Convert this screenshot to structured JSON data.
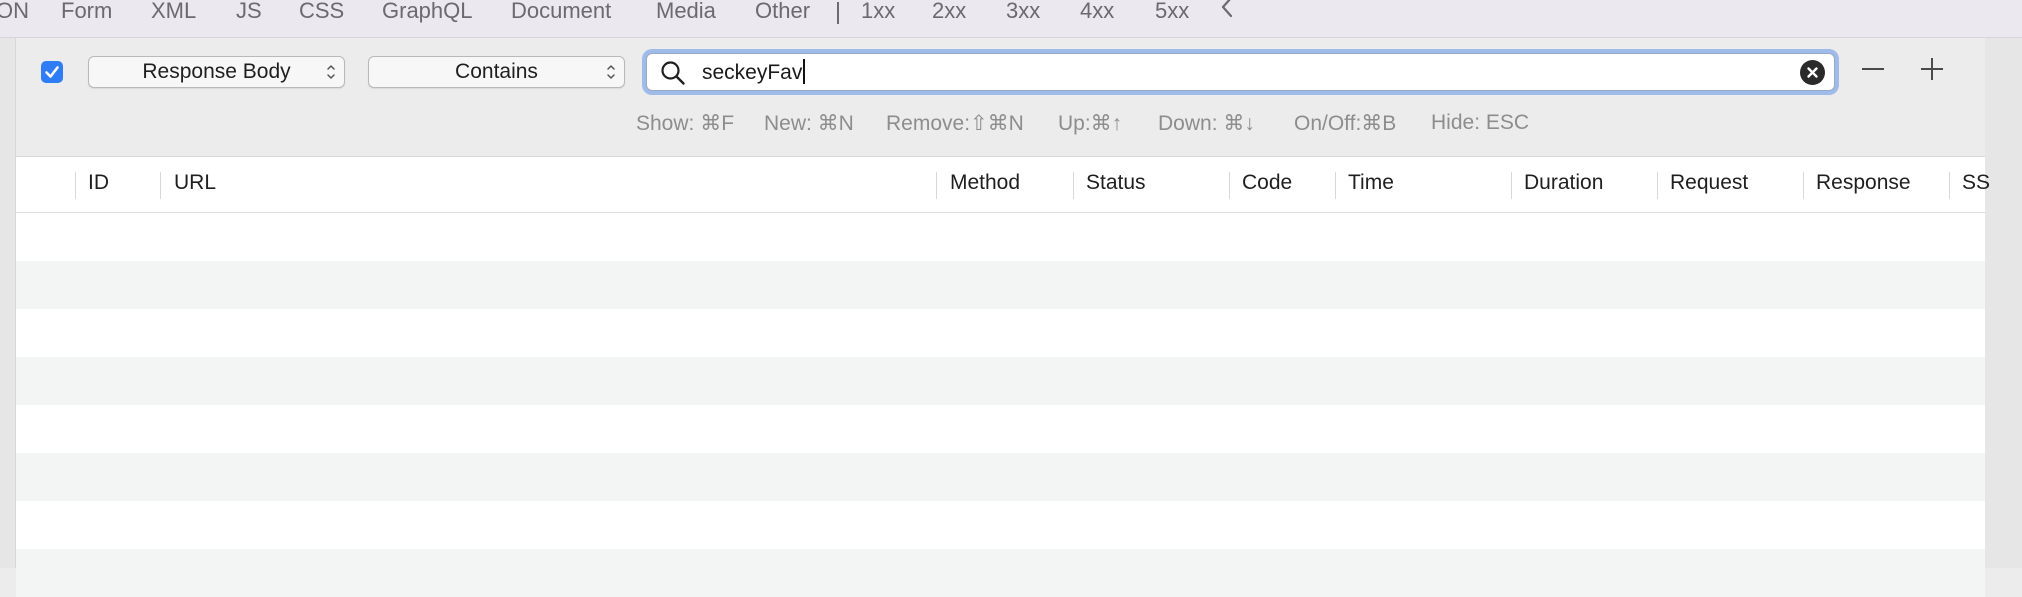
{
  "filter_tabs": [
    "ON",
    "Form",
    "XML",
    "JS",
    "CSS",
    "GraphQL",
    "Document",
    "Media",
    "Other"
  ],
  "status_tabs": [
    "1xx",
    "2xx",
    "3xx",
    "4xx",
    "5xx"
  ],
  "filter_rule": {
    "enabled": true,
    "field": "Response Body",
    "operator": "Contains",
    "search_value": "seckeyFav"
  },
  "shortcuts": {
    "show": "Show: ⌘F",
    "new": "New: ⌘N",
    "remove": "Remove:⇧⌘N",
    "up": "Up:⌘↑",
    "down": "Down: ⌘↓",
    "onoff": "On/Off:⌘B",
    "hide": "Hide: ESC"
  },
  "table": {
    "columns": [
      "ID",
      "URL",
      "Method",
      "Status",
      "Code",
      "Time",
      "Duration",
      "Request",
      "Response",
      "SS"
    ],
    "row_count": 7
  },
  "colors": {
    "accent": "#2f7df6",
    "focus_ring": "#9fbbea",
    "row_alt": "#f3f4f4"
  }
}
